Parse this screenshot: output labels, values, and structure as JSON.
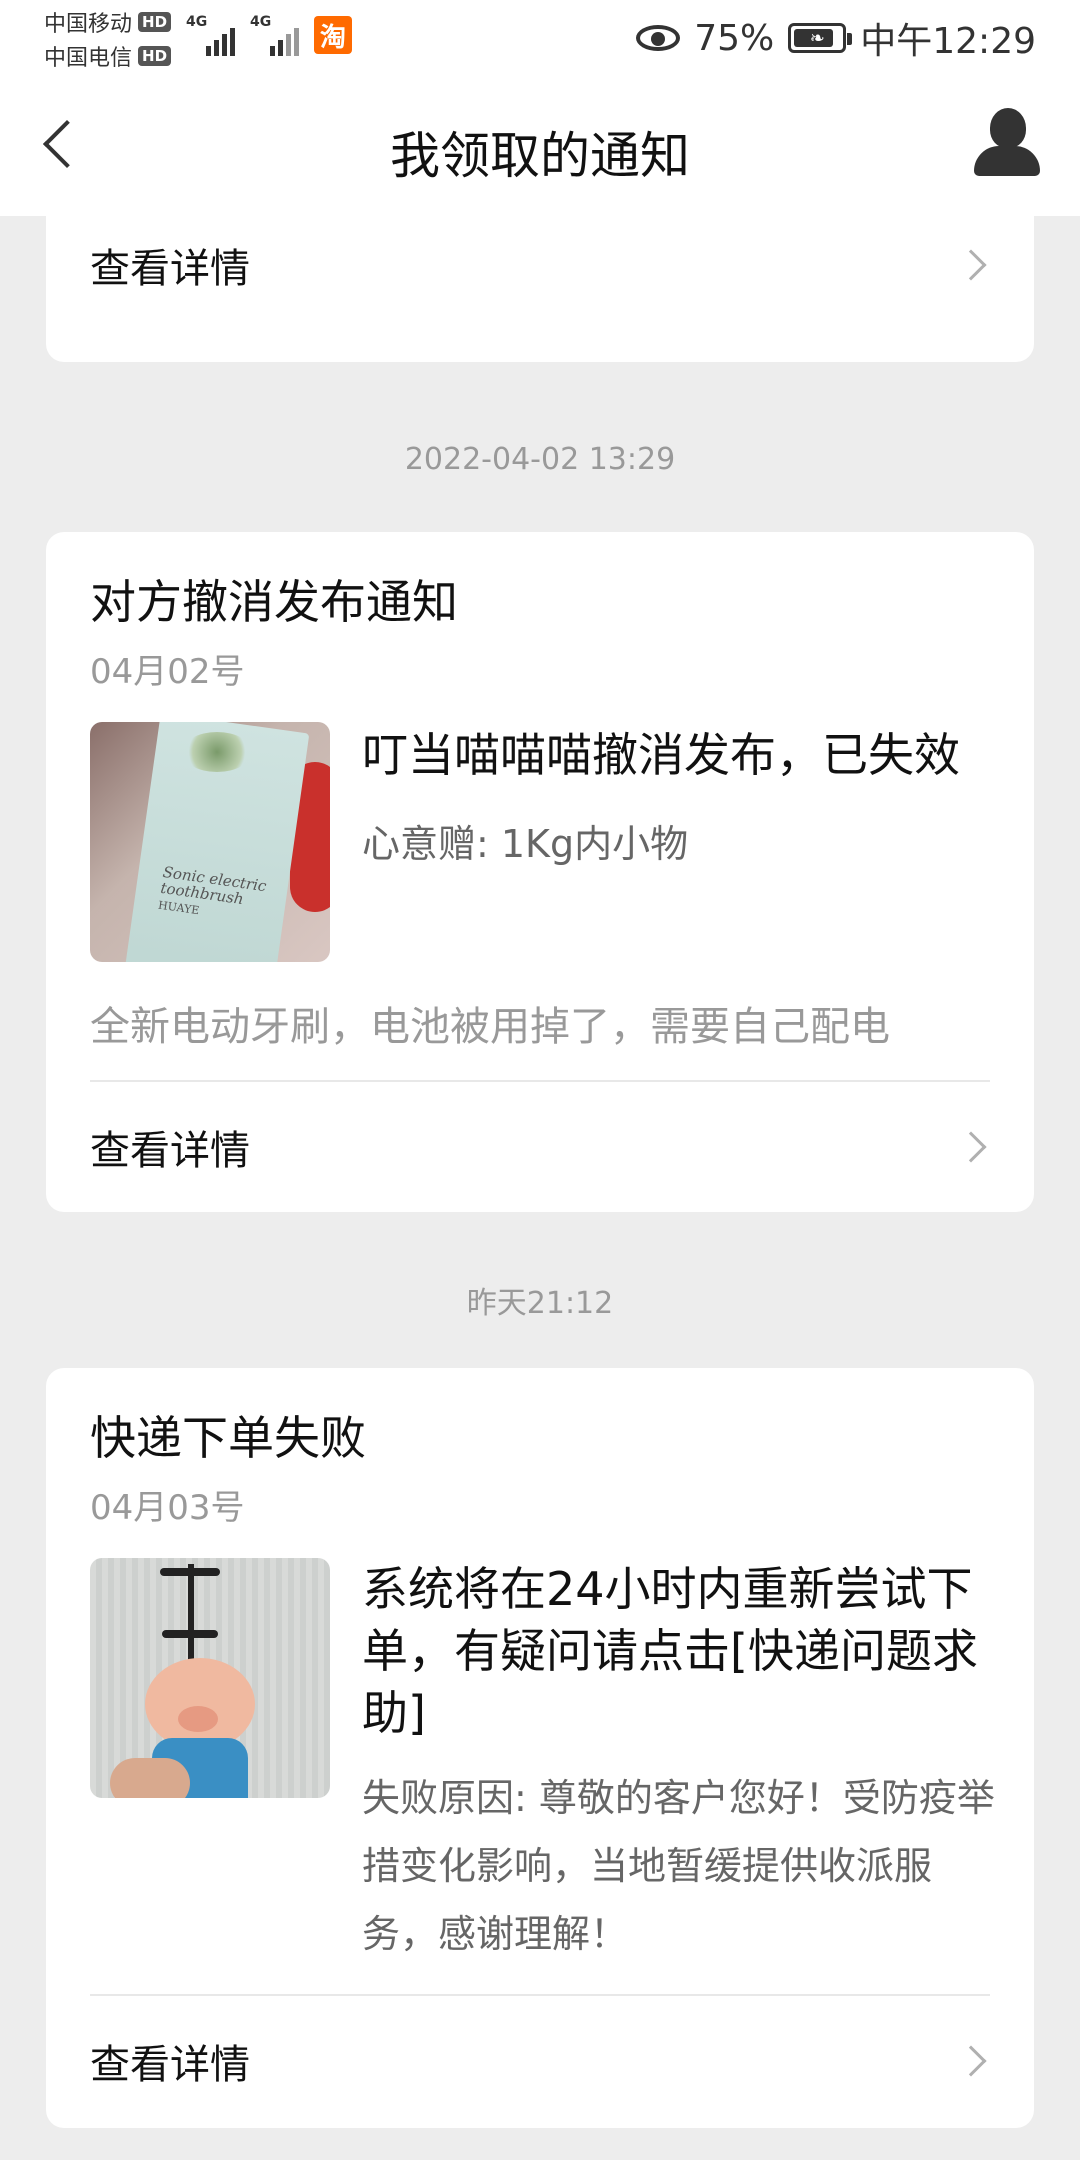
{
  "status_bar": {
    "carrier_1": "中国移动",
    "carrier_2": "中国电信",
    "hd": "HD",
    "network_1": "4G",
    "network_2": "4G",
    "app_badge": "淘",
    "battery": "75%",
    "time": "中午12:29"
  },
  "header": {
    "title": "我领取的通知"
  },
  "cards": [
    {
      "detail_label": "查看详情"
    },
    {
      "timestamp": "2022-04-02 13:29",
      "title": "对方撤消发布通知",
      "date": "04月02号",
      "main_text": "叮当喵喵喵撤消发布，已失效",
      "sub_text": "心意赠: 1Kg内小物",
      "description": "全新电动牙刷，电池被用掉了，需要自己配电",
      "thumb_text": "Sonic electric toothbrush",
      "thumb_brand": "HUAYE",
      "detail_label": "查看详情"
    },
    {
      "timestamp": "昨天21:12",
      "title": "快递下单失败",
      "date": "04月03号",
      "main_text": "系统将在24小时内重新尝试下单，有疑问请点击[快递问题求助]",
      "sub_text": "失败原因: 尊敬的客户您好！受防疫举措变化影响，当地暂缓提供收派服务，感谢理解！",
      "detail_label": "查看详情"
    }
  ]
}
